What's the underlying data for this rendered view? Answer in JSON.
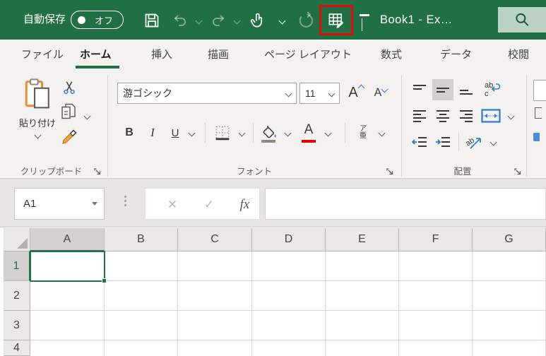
{
  "window": {
    "autosave_label": "自動保存",
    "autosave_state": "オフ",
    "doc_title": "Book1  -  Ex…"
  },
  "quick_access_icons": [
    "save",
    "undo",
    "redo",
    "touch-mouse-mode",
    "repeat",
    "edit-table-highlighted",
    "customize-quick-access-toolbar",
    "search"
  ],
  "tabs": [
    "ファイル",
    "ホーム",
    "挿入",
    "描画",
    "ページ レイアウト",
    "数式",
    "データ",
    "校閲"
  ],
  "active_tab": "ホーム",
  "ribbon": {
    "clipboard": {
      "group_label": "クリップボード",
      "paste_label": "貼り付け"
    },
    "font": {
      "group_label": "フォント",
      "font_name": "游ゴシック",
      "font_size": "11",
      "bold_label": "B",
      "italic_label": "I",
      "underline_label": "U",
      "increase_font_label": "A",
      "decrease_font_label": "A",
      "phonetic_top": "ア",
      "phonetic_bottom": "亜"
    },
    "alignment": {
      "group_label": "配置",
      "wrap_ab": "ab",
      "wrap_c": "c",
      "orientation_ab": "ab"
    }
  },
  "formula_bar": {
    "name_box_value": "A1",
    "insert_function_label": "fx",
    "cancel_glyph": "✕",
    "enter_glyph": "✓",
    "formula_value": ""
  },
  "grid": {
    "column_headers": [
      "A",
      "B",
      "C",
      "D",
      "E",
      "F",
      "G"
    ],
    "row_headers": [
      "1",
      "2",
      "3",
      "4"
    ],
    "selected_cell": "A1",
    "selected_column": "A",
    "selected_row": "1"
  },
  "colors": {
    "titlebar_green": "#207044",
    "accent_green": "#217346",
    "annotation_red": "#e20b0b",
    "search_bg": "#b9d2c4",
    "blue_accent": "#2b7cd3",
    "orange_accent": "#ed8b33",
    "font_color_red": "#eb0000"
  }
}
